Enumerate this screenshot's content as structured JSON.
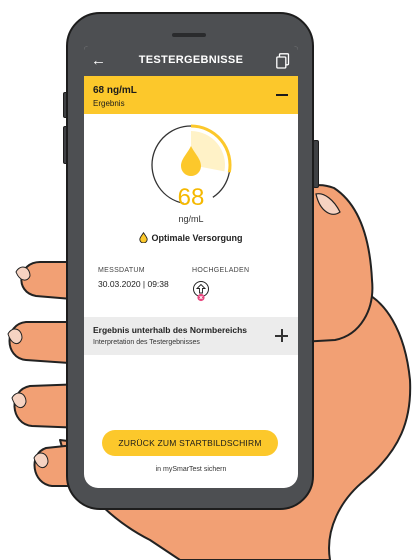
{
  "header": {
    "title": "TESTERGEBNISSE",
    "back_icon": "arrow-left-icon",
    "share_icon": "export-document-icon"
  },
  "result_bar": {
    "value": "68 ng/mL",
    "label": "Ergebnis",
    "collapse_icon": "minus-icon"
  },
  "gauge": {
    "value": "68",
    "unit": "ng/mL",
    "fill_fraction": 0.28,
    "accent_color": "#fcc82b",
    "icon": "drop-icon"
  },
  "status": {
    "text": "Optimale Versorgung",
    "icon": "drop-icon"
  },
  "details": {
    "date_label": "MESSDATUM",
    "date_value": "30.03.2020 | 09:38",
    "upload_label": "HOCHGELADEN",
    "upload_icon": "upload-icon",
    "upload_status_icon": "error-cross-icon"
  },
  "interpretation": {
    "title": "Ergebnis unterhalb des Normbereichs",
    "subtitle": "Interpretation des Testergebnisses",
    "expand_icon": "plus-icon"
  },
  "actions": {
    "primary_label": "ZURÜCK ZUM STARTBILDSCHIRM",
    "secondary_label": "in mySmarTest sichern"
  },
  "colors": {
    "brand_yellow": "#fcc82b",
    "header_gray": "#4d4f52",
    "skin": "#f2a074"
  }
}
